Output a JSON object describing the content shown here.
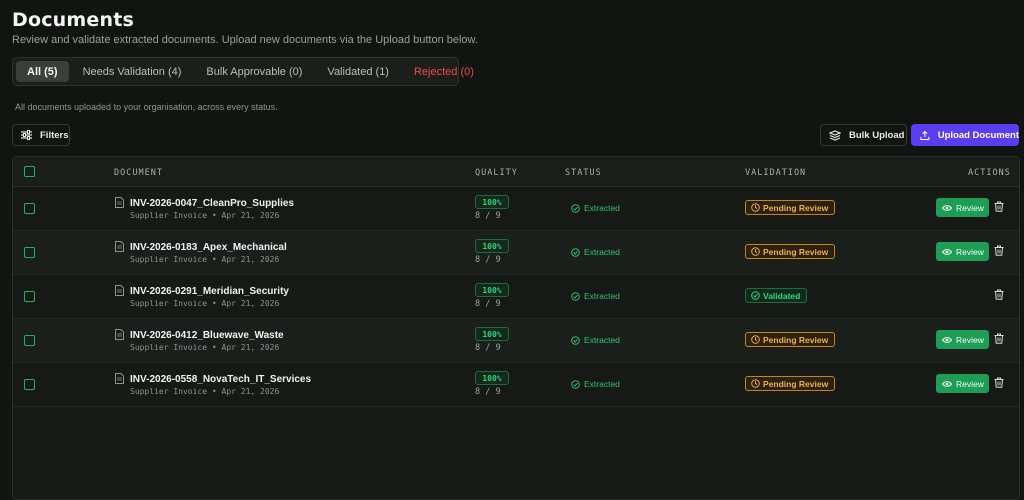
{
  "header": {
    "title": "Documents",
    "subtitle": "Review and validate extracted documents. Upload new documents via the Upload button below."
  },
  "tabs": [
    {
      "label": "All (5)",
      "active": true
    },
    {
      "label": "Needs Validation (4)",
      "active": false
    },
    {
      "label": "Bulk Approvable (0)",
      "active": false
    },
    {
      "label": "Validated (1)",
      "active": false
    },
    {
      "label": "Rejected (0)",
      "active": false,
      "color": "#ef4a45"
    }
  ],
  "tab_caption": "All documents uploaded to your organisation, across every status.",
  "toolbar": {
    "filters_label": "Filters",
    "bulk_upload_label": "Bulk Upload",
    "upload_label": "Upload Document"
  },
  "table": {
    "columns": [
      "DOCUMENT",
      "QUALITY",
      "STATUS",
      "VALIDATION",
      "ACTIONS"
    ],
    "rows": [
      {
        "name": "INV-2026-0047_CleanPro_Supplies",
        "meta": "Supplier Invoice • Apr 21, 2026",
        "quality": "100%",
        "fields": "8 / 9",
        "status": "Extracted",
        "validation": "Pending Review",
        "review_label": "Review"
      },
      {
        "name": "INV-2026-0183_Apex_Mechanical",
        "meta": "Supplier Invoice • Apr 21, 2026",
        "quality": "100%",
        "fields": "8 / 9",
        "status": "Extracted",
        "validation": "Pending Review",
        "review_label": "Review"
      },
      {
        "name": "INV-2026-0291_Meridian_Security",
        "meta": "Supplier Invoice • Apr 21, 2026",
        "quality": "100%",
        "fields": "8 / 9",
        "status": "Extracted",
        "validation": "Validated",
        "review_label": ""
      },
      {
        "name": "INV-2026-0412_Bluewave_Waste",
        "meta": "Supplier Invoice • Apr 21, 2026",
        "quality": "100%",
        "fields": "8 / 9",
        "status": "Extracted",
        "validation": "Pending Review",
        "review_label": "Review"
      },
      {
        "name": "INV-2026-0558_NovaTech_IT_Services",
        "meta": "Supplier Invoice • Apr 21, 2026",
        "quality": "100%",
        "fields": "8 / 9",
        "status": "Extracted",
        "validation": "Pending Review",
        "review_label": "Review"
      }
    ]
  },
  "colors": {
    "background": "#121412",
    "accent_purple": "#5b3df0",
    "success_green": "#1f9d55",
    "warning_amber": "#f3b03e",
    "danger_red": "#ef4a45"
  },
  "icons": [
    "filter-icon",
    "bulk-upload-icon",
    "upload-icon",
    "document-icon",
    "check-circle-icon",
    "clock-icon",
    "eye-icon",
    "trash-icon"
  ]
}
